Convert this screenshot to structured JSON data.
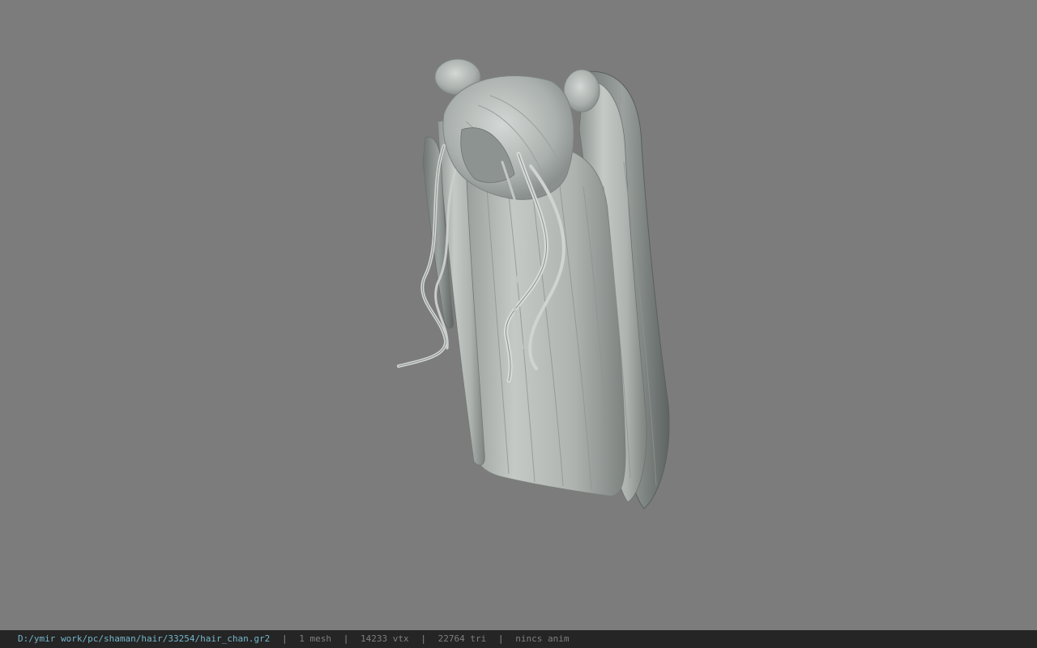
{
  "viewport": {
    "background_color": "#7c7c7c",
    "model_color": "#b9bdbb",
    "model_subject": "hair mesh (twin ponytails)"
  },
  "statusbar": {
    "file_path": "D:/ymir work/pc/shaman/hair/33254/hair_chan.gr2",
    "separator": "|",
    "mesh_count": "1 mesh",
    "vertex_count": "14233 vtx",
    "triangle_count": "22764 tri",
    "anim_status": "nincs anim",
    "path_color": "#73b6c9"
  }
}
